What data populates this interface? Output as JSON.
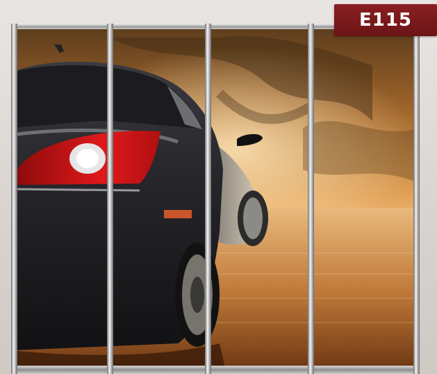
{
  "badge": {
    "code": "E115",
    "color": "#7a1a1c"
  },
  "wardrobe": {
    "panels": [
      "panel-1",
      "panel-2",
      "panel-3",
      "panel-4"
    ],
    "frame_color": "#b8b8b8",
    "photo_subject": "sports-car-on-water"
  }
}
